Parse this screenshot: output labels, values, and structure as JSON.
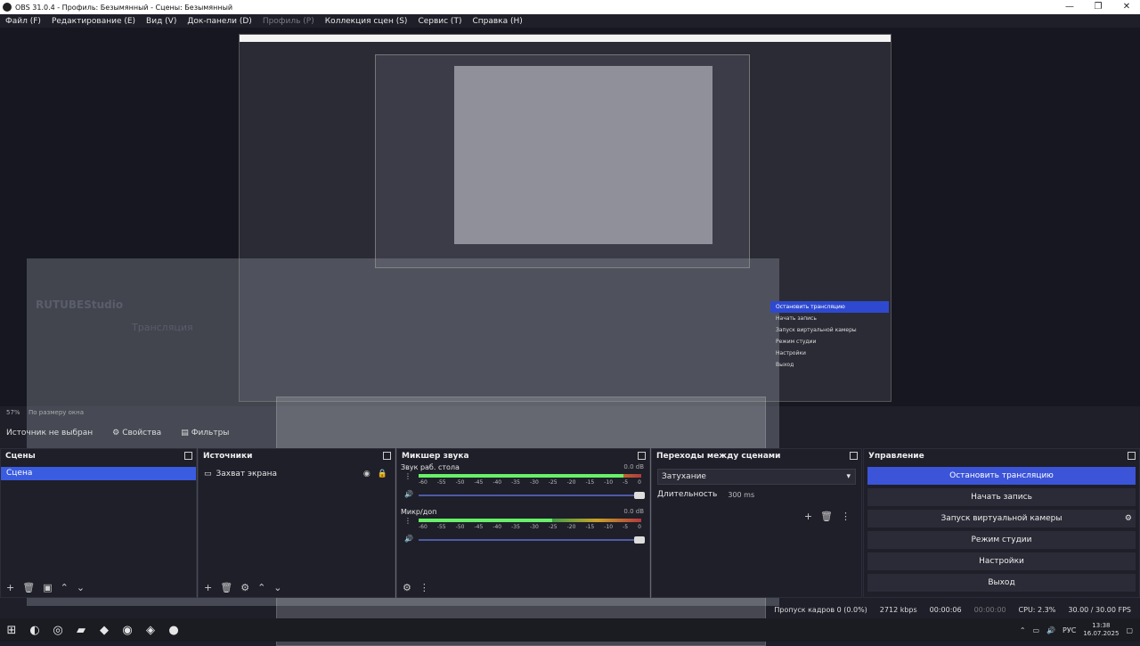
{
  "window": {
    "title": "OBS 31.0.4 - Профиль: Безымянный - Сцены: Безымянный",
    "minimize": "—",
    "maximize": "❐",
    "close": "✕"
  },
  "menu": {
    "items": [
      "Файл (F)",
      "Редактирование (E)",
      "Вид (V)",
      "Док-панели (D)",
      "Профиль (P)",
      "Коллекция сцен (S)",
      "Сервис (T)",
      "Справка (H)"
    ]
  },
  "preview": {
    "ghost_logo": "RUTUBEStudio",
    "ghost_title": "Трансляция",
    "nested_controls": [
      "Остановить трансляцию",
      "Начать запись",
      "Запуск виртуальной камеры",
      "Режим студии",
      "Настройки",
      "Выход"
    ],
    "zoom": "57%",
    "zoom_mode": "По размеру окна"
  },
  "sourcebar": {
    "no_source": "Источник не выбран",
    "properties": "Свойства",
    "filters": "Фильтры"
  },
  "scenes": {
    "title": "Сцены",
    "items": [
      "Сцена"
    ]
  },
  "sources": {
    "title": "Источники",
    "items": [
      "Захват экрана"
    ]
  },
  "mixer": {
    "title": "Микшер звука",
    "scale": [
      "-60",
      "-55",
      "-50",
      "-45",
      "-40",
      "-35",
      "-30",
      "-25",
      "-20",
      "-15",
      "-10",
      "-5",
      "0"
    ],
    "channels": [
      {
        "name": "Звук раб. стола",
        "db": "0.0 dB",
        "level": 0.92
      },
      {
        "name": "Микр/доп",
        "db": "0.0 dB",
        "level": 0.6
      }
    ]
  },
  "transitions": {
    "title": "Переходы между сценами",
    "selected": "Затухание",
    "duration_label": "Длительность",
    "duration_value": "300 ms"
  },
  "controls": {
    "title": "Управление",
    "buttons": [
      "Остановить трансляцию",
      "Начать запись",
      "Запуск виртуальной камеры",
      "Режим студии",
      "Настройки",
      "Выход"
    ]
  },
  "status": {
    "dropped": "Пропуск кадров 0 (0.0%)",
    "bitrate": "2712 kbps",
    "stream_time": "00:00:06",
    "rec_time": "00:00:00",
    "cpu": "CPU: 2.3%",
    "fps": "30.00 / 30.00 FPS"
  },
  "taskbar": {
    "lang": "РУС",
    "time": "13:38",
    "date": "16.07.2025"
  },
  "colors": {
    "accent": "#3b54d8",
    "panel": "#1e1f29"
  }
}
